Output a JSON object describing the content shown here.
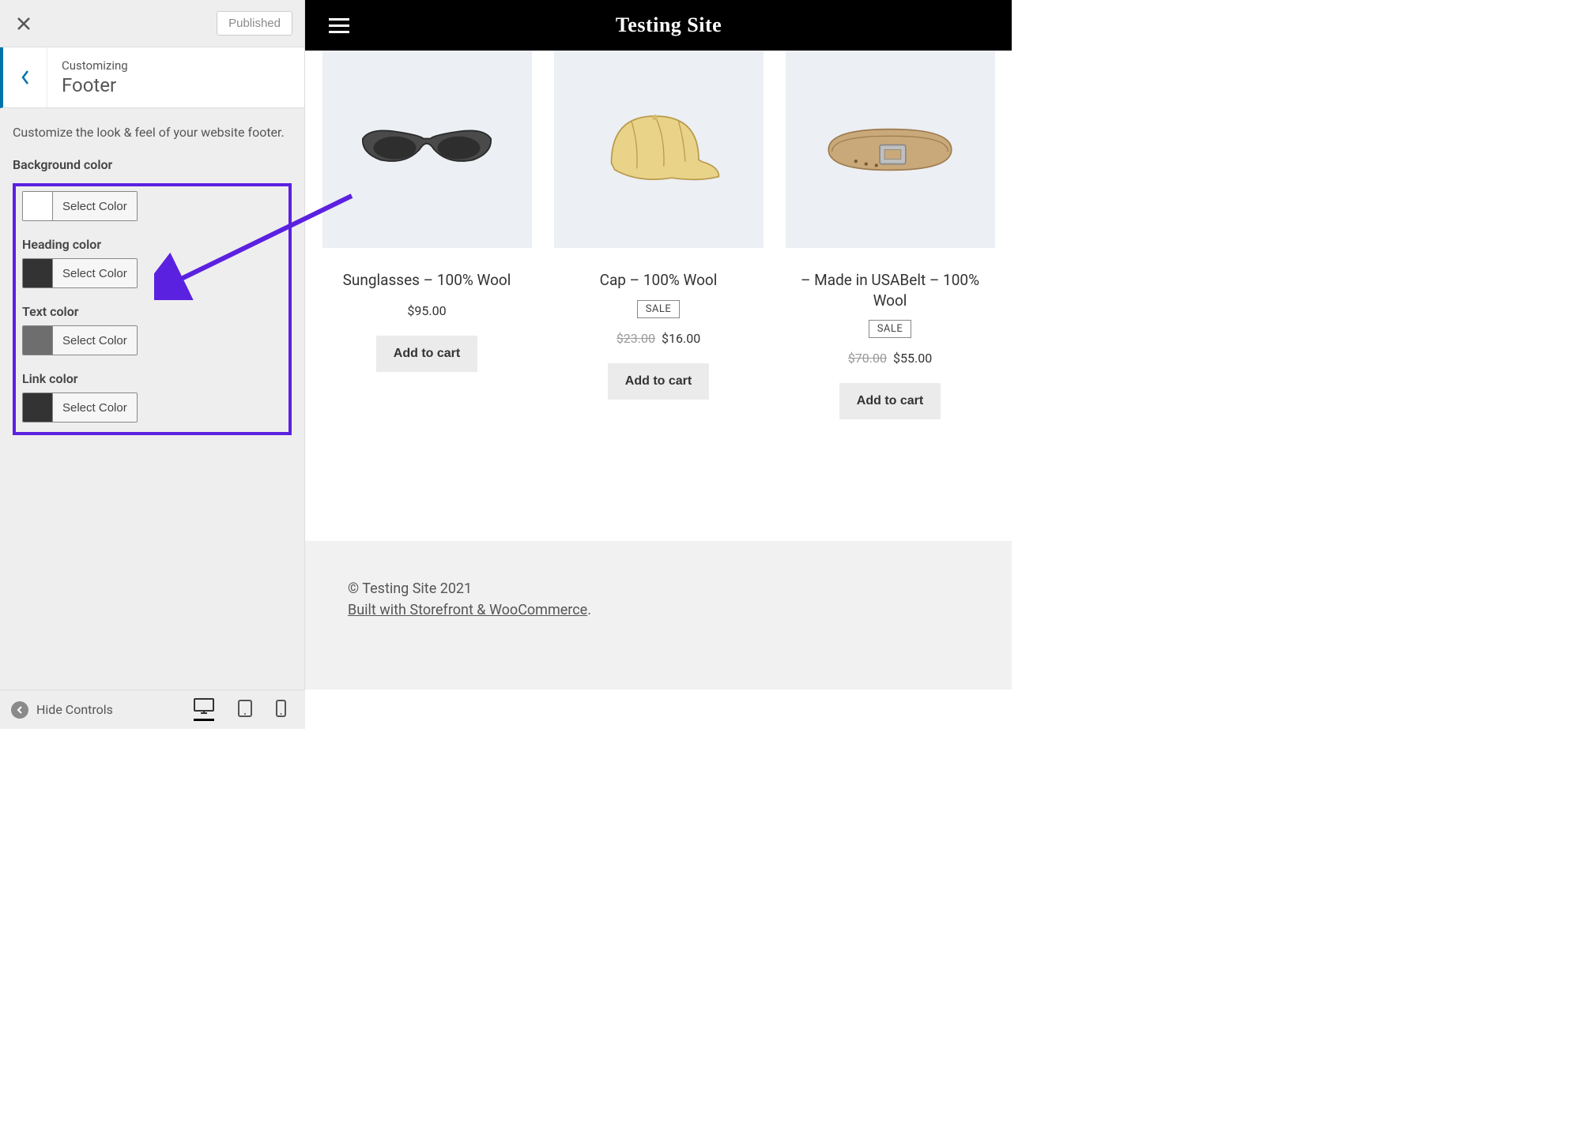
{
  "sidebar": {
    "close_icon": "×",
    "published_label": "Published",
    "back_icon": "chevron-left",
    "sup": "Customizing",
    "title": "Footer",
    "description": "Customize the look & feel of your website footer.",
    "select_color_label": "Select Color",
    "controls": [
      {
        "label": "Background color",
        "swatch": "#ffffff"
      },
      {
        "label": "Heading color",
        "swatch": "#333333"
      },
      {
        "label": "Text color",
        "swatch": "#6e6e6e"
      },
      {
        "label": "Link color",
        "swatch": "#333333"
      }
    ]
  },
  "preview": {
    "site_title": "Testing Site",
    "products": [
      {
        "title": "Sunglasses – 100% Wool",
        "sale": false,
        "old_price": "",
        "price": "$95.00",
        "icon": "sunglasses"
      },
      {
        "title": "Cap – 100% Wool",
        "sale": true,
        "old_price": "$23.00",
        "price": "$16.00",
        "icon": "cap"
      },
      {
        "title": "– Made in USABelt – 100% Wool",
        "sale": true,
        "old_price": "$70.00",
        "price": "$55.00",
        "icon": "belt"
      }
    ],
    "sale_label": "SALE",
    "add_to_cart_label": "Add to cart",
    "footer_copyright": "© Testing Site 2021",
    "footer_link": "Built with Storefront & WooCommerce",
    "footer_period": "."
  },
  "bottombar": {
    "hide_controls_label": "Hide Controls"
  },
  "annotation": {
    "arrow_color": "#5b21e0"
  }
}
